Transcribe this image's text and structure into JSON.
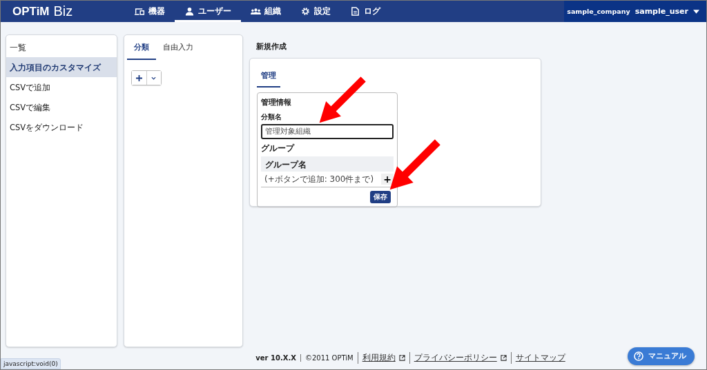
{
  "header": {
    "logo": {
      "brand": "OPTiM",
      "product": "Biz"
    },
    "nav": [
      {
        "label": "機器",
        "kind": "devices",
        "selected": false
      },
      {
        "label": "ユーザー",
        "kind": "users",
        "selected": true
      },
      {
        "label": "組織",
        "kind": "groups",
        "selected": false
      },
      {
        "label": "設定",
        "kind": "settings",
        "selected": false
      },
      {
        "label": "ログ",
        "kind": "logs",
        "selected": false
      }
    ],
    "account": {
      "company": "sample_company",
      "user": "sample_user"
    }
  },
  "sidebar": {
    "items": [
      {
        "label": "一覧",
        "selected": false
      },
      {
        "label": "入力項目のカスタマイズ",
        "selected": true
      },
      {
        "label": "CSVで追加",
        "selected": false
      },
      {
        "label": "CSVで編集",
        "selected": false
      },
      {
        "label": "CSVをダウンロード",
        "selected": false
      }
    ]
  },
  "category_panel": {
    "tabs": [
      {
        "label": "分類",
        "selected": true
      },
      {
        "label": "自由入力",
        "selected": false
      }
    ]
  },
  "form": {
    "title": "新規作成",
    "tabs": [
      {
        "label": "管理",
        "selected": true
      }
    ],
    "section": {
      "title": "管理情報",
      "field_label": "分類名",
      "field_value": "管理対象組織",
      "group_label": "グループ",
      "table_header": "グループ名",
      "row_hint": "(+ボタンで追加: 300件まで)",
      "add_label": "+",
      "save_button": "保存"
    },
    "annotation_arrows": [
      {
        "kind": "arrow"
      },
      {
        "kind": "arrow"
      }
    ]
  },
  "footer": {
    "version": "ver 10.X.X",
    "copyright": "©2011 OPTiM",
    "links": [
      {
        "label": "利用規約",
        "external": true
      },
      {
        "label": "プライバシーポリシー",
        "external": true
      },
      {
        "label": "サイトマップ",
        "external": false
      }
    ]
  },
  "status_url": "javascript:void(0)",
  "manual_button": "マニュアル"
}
